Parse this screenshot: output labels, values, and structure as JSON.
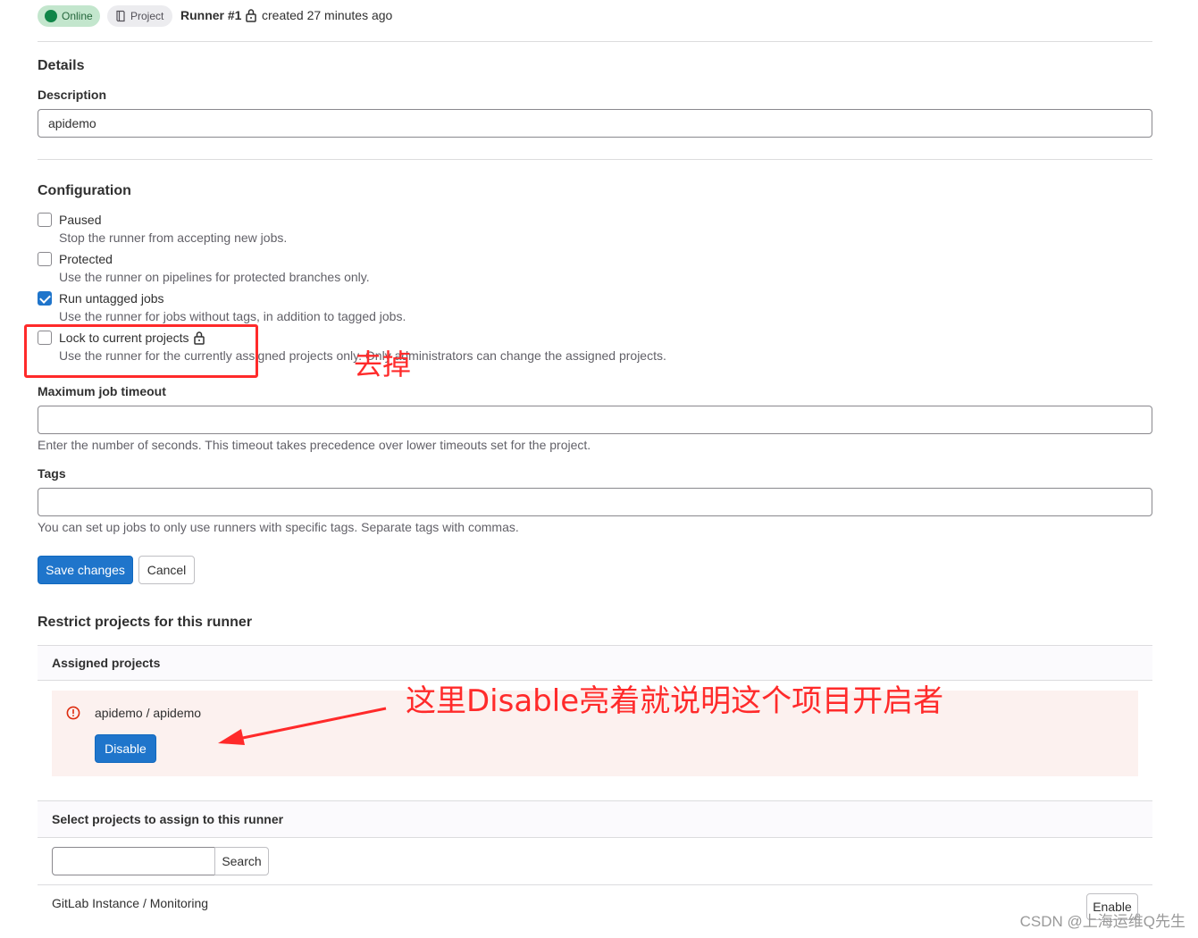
{
  "header": {
    "status_badge": "Online",
    "type_badge": "Project",
    "runner_title": "Runner #1",
    "created": "created 27 minutes ago"
  },
  "details": {
    "heading": "Details",
    "description_label": "Description",
    "description_value": "apidemo"
  },
  "configuration": {
    "heading": "Configuration",
    "options": [
      {
        "label": "Paused",
        "help": "Stop the runner from accepting new jobs.",
        "checked": false
      },
      {
        "label": "Protected",
        "help": "Use the runner on pipelines for protected branches only.",
        "checked": false
      },
      {
        "label": "Run untagged jobs",
        "help": "Use the runner for jobs without tags, in addition to tagged jobs.",
        "checked": true
      },
      {
        "label": "Lock to current projects",
        "help": "Use the runner for the currently assigned projects only. Only administrators can change the assigned projects.",
        "checked": false
      }
    ],
    "timeout_label": "Maximum job timeout",
    "timeout_value": "",
    "timeout_help": "Enter the number of seconds. This timeout takes precedence over lower timeouts set for the project.",
    "tags_label": "Tags",
    "tags_value": "",
    "tags_help": "You can set up jobs to only use runners with specific tags. Separate tags with commas.",
    "save_label": "Save changes",
    "cancel_label": "Cancel"
  },
  "restrict": {
    "heading": "Restrict projects for this runner",
    "assigned_heading": "Assigned projects",
    "assigned_project": "apidemo / apidemo",
    "disable_label": "Disable",
    "select_heading": "Select projects to assign to this runner",
    "search_value": "",
    "search_label": "Search",
    "available_project": "GitLab Instance / Monitoring",
    "enable_label": "Enable"
  },
  "annotations": {
    "remove_note": "去掉",
    "disable_note": "这里Disable亮着就说明这个项目开启者",
    "color": "#ff2a2a"
  },
  "watermark": "CSDN @上海运维Q先生",
  "colors": {
    "primary": "#1f75cb",
    "online_bg": "#c3e6cd",
    "online_dot": "#108548",
    "danger_bg": "#fcf1ef",
    "danger_icon": "#dd2b0e"
  }
}
